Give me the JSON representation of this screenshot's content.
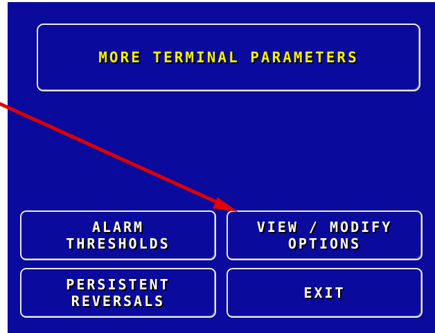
{
  "screen": {
    "title": "MORE TERMINAL PARAMETERS"
  },
  "buttons": {
    "alarm_thresholds": {
      "line1": "ALARM",
      "line2": "THRESHOLDS"
    },
    "view_modify_options": {
      "line1": "VIEW / MODIFY",
      "line2": "OPTIONS"
    },
    "persistent_reversals": {
      "line1": "PERSISTENT",
      "line2": "REVERSALS"
    },
    "exit": {
      "label": "EXIT"
    }
  },
  "colors": {
    "screen_background": "#0a0a9c",
    "title_text": "#f4f000",
    "button_text": "#ffffff",
    "border": "#e8e8e8",
    "annotation_arrow": "#e00000"
  },
  "annotation": {
    "icon": "red-arrow-pointer",
    "points_to": "view_modify_options"
  }
}
